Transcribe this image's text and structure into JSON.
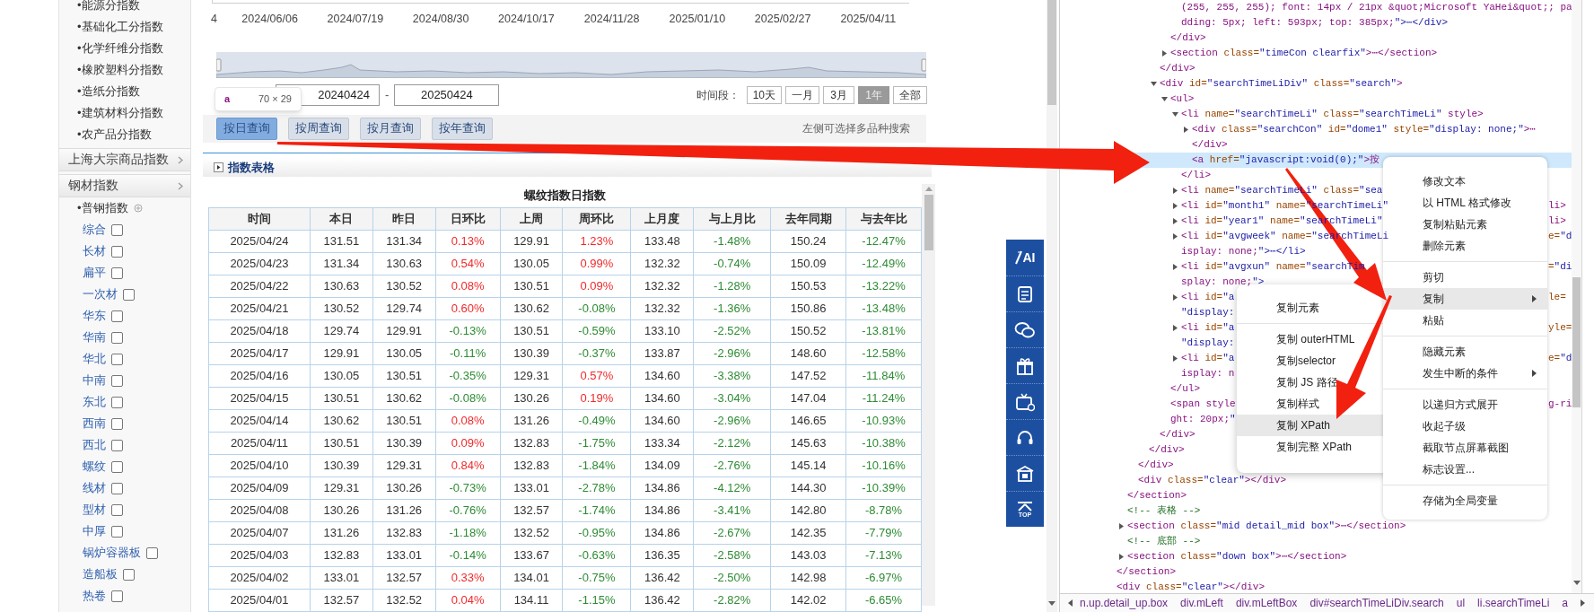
{
  "sidebar": {
    "sections": [
      {
        "items": [
          "•能源分指数",
          "•基础化工分指数",
          "•化学纤维分指数",
          "•橡胶塑料分指数",
          "•造纸分指数",
          "•建筑材料分指数",
          "•农产品分指数"
        ]
      },
      {
        "label": "上海大宗商品指数"
      },
      {
        "label": "钢材指数",
        "children": [
          {
            "label": "•普钢指数",
            "children": [
              {
                "label": "综合",
                "checked": false
              },
              {
                "label": "长材",
                "checked": false
              },
              {
                "label": "扁平",
                "checked": false
              },
              {
                "label": "一次材",
                "checked": false
              },
              {
                "label": "华东",
                "checked": false
              },
              {
                "label": "华南",
                "checked": false
              },
              {
                "label": "华北",
                "checked": false
              },
              {
                "label": "中南",
                "checked": false
              },
              {
                "label": "东北",
                "checked": false
              },
              {
                "label": "西南",
                "checked": false
              },
              {
                "label": "西北",
                "checked": false
              },
              {
                "label": "螺纹",
                "checked": false
              },
              {
                "label": "线材",
                "checked": false
              },
              {
                "label": "型材",
                "checked": false
              },
              {
                "label": "中厚",
                "checked": false
              },
              {
                "label": "锅炉容器板",
                "checked": false
              },
              {
                "label": "造船板",
                "checked": false
              },
              {
                "label": "热卷",
                "checked": false
              }
            ]
          }
        ]
      }
    ]
  },
  "chart": {
    "axis_labels": [
      "4",
      "2024/06/06",
      "2024/07/19",
      "2024/08/30",
      "2024/10/17",
      "2024/11/28",
      "2025/01/10",
      "2025/02/27",
      "2025/04/11"
    ]
  },
  "date_range": {
    "start": "20240424",
    "separator": "-",
    "end": "20250424"
  },
  "period": {
    "label": "时间段：",
    "options": [
      {
        "label": "10天",
        "selected": false
      },
      {
        "label": "一月",
        "selected": false
      },
      {
        "label": "3月",
        "selected": false
      },
      {
        "label": "1年",
        "selected": true
      },
      {
        "label": "全部",
        "selected": false
      }
    ]
  },
  "query_buttons": [
    {
      "label": "按日查询",
      "selected": true
    },
    {
      "label": "按周查询",
      "selected": false
    },
    {
      "label": "按月查询",
      "selected": false
    },
    {
      "label": "按年查询",
      "selected": false
    }
  ],
  "hint": "左侧可选择多品种搜索",
  "tooltip": {
    "tag": "a",
    "size": "70 × 29"
  },
  "section": {
    "title": "指数表格"
  },
  "table": {
    "title": "螺纹指数日指数",
    "columns": [
      "时间",
      "本日",
      "昨日",
      "日环比",
      "上周",
      "周环比",
      "上月度",
      "与上月比",
      "去年同期",
      "与去年比"
    ],
    "rows": [
      [
        "2025/04/24",
        "131.51",
        "131.34",
        {
          "text": "0.13%",
          "color": "#f02a2a"
        },
        "129.91",
        {
          "text": "1.23%",
          "color": "#f02a2a"
        },
        "133.48",
        {
          "text": "-1.48%",
          "color": "#2e8b34"
        },
        "150.24",
        {
          "text": "-12.47%",
          "color": "#2e8b34"
        }
      ],
      [
        "2025/04/23",
        "131.34",
        "130.63",
        {
          "text": "0.54%",
          "color": "#f02a2a"
        },
        "130.05",
        {
          "text": "0.99%",
          "color": "#f02a2a"
        },
        "132.32",
        {
          "text": "-0.74%",
          "color": "#2e8b34"
        },
        "150.09",
        {
          "text": "-12.49%",
          "color": "#2e8b34"
        }
      ],
      [
        "2025/04/22",
        "130.63",
        "130.52",
        {
          "text": "0.08%",
          "color": "#f02a2a"
        },
        "130.51",
        {
          "text": "0.09%",
          "color": "#f02a2a"
        },
        "132.32",
        {
          "text": "-1.28%",
          "color": "#2e8b34"
        },
        "150.53",
        {
          "text": "-13.22%",
          "color": "#2e8b34"
        }
      ],
      [
        "2025/04/21",
        "130.52",
        "129.74",
        {
          "text": "0.60%",
          "color": "#f02a2a"
        },
        "130.62",
        {
          "text": "-0.08%",
          "color": "#2e8b34"
        },
        "132.32",
        {
          "text": "-1.36%",
          "color": "#2e8b34"
        },
        "150.86",
        {
          "text": "-13.48%",
          "color": "#2e8b34"
        }
      ],
      [
        "2025/04/18",
        "129.74",
        "129.91",
        {
          "text": "-0.13%",
          "color": "#2e8b34"
        },
        "130.51",
        {
          "text": "-0.59%",
          "color": "#2e8b34"
        },
        "133.10",
        {
          "text": "-2.52%",
          "color": "#2e8b34"
        },
        "150.52",
        {
          "text": "-13.81%",
          "color": "#2e8b34"
        }
      ],
      [
        "2025/04/17",
        "129.91",
        "130.05",
        {
          "text": "-0.11%",
          "color": "#2e8b34"
        },
        "130.39",
        {
          "text": "-0.37%",
          "color": "#2e8b34"
        },
        "133.87",
        {
          "text": "-2.96%",
          "color": "#2e8b34"
        },
        "148.60",
        {
          "text": "-12.58%",
          "color": "#2e8b34"
        }
      ],
      [
        "2025/04/16",
        "130.05",
        "130.51",
        {
          "text": "-0.35%",
          "color": "#2e8b34"
        },
        "129.31",
        {
          "text": "0.57%",
          "color": "#f02a2a"
        },
        "134.60",
        {
          "text": "-3.38%",
          "color": "#2e8b34"
        },
        "147.52",
        {
          "text": "-11.84%",
          "color": "#2e8b34"
        }
      ],
      [
        "2025/04/15",
        "130.51",
        "130.62",
        {
          "text": "-0.08%",
          "color": "#2e8b34"
        },
        "130.26",
        {
          "text": "0.19%",
          "color": "#f02a2a"
        },
        "134.60",
        {
          "text": "-3.04%",
          "color": "#2e8b34"
        },
        "147.04",
        {
          "text": "-11.24%",
          "color": "#2e8b34"
        }
      ],
      [
        "2025/04/14",
        "130.62",
        "130.51",
        {
          "text": "0.08%",
          "color": "#f02a2a"
        },
        "131.26",
        {
          "text": "-0.49%",
          "color": "#2e8b34"
        },
        "134.60",
        {
          "text": "-2.96%",
          "color": "#2e8b34"
        },
        "146.65",
        {
          "text": "-10.93%",
          "color": "#2e8b34"
        }
      ],
      [
        "2025/04/11",
        "130.51",
        "130.39",
        {
          "text": "0.09%",
          "color": "#f02a2a"
        },
        "132.83",
        {
          "text": "-1.75%",
          "color": "#2e8b34"
        },
        "133.34",
        {
          "text": "-2.12%",
          "color": "#2e8b34"
        },
        "145.63",
        {
          "text": "-10.38%",
          "color": "#2e8b34"
        }
      ],
      [
        "2025/04/10",
        "130.39",
        "129.31",
        {
          "text": "0.84%",
          "color": "#f02a2a"
        },
        "132.83",
        {
          "text": "-1.84%",
          "color": "#2e8b34"
        },
        "134.09",
        {
          "text": "-2.76%",
          "color": "#2e8b34"
        },
        "145.14",
        {
          "text": "-10.16%",
          "color": "#2e8b34"
        }
      ],
      [
        "2025/04/09",
        "129.31",
        "130.26",
        {
          "text": "-0.73%",
          "color": "#2e8b34"
        },
        "133.01",
        {
          "text": "-2.78%",
          "color": "#2e8b34"
        },
        "134.86",
        {
          "text": "-4.12%",
          "color": "#2e8b34"
        },
        "144.30",
        {
          "text": "-10.39%",
          "color": "#2e8b34"
        }
      ],
      [
        "2025/04/08",
        "130.26",
        "131.26",
        {
          "text": "-0.76%",
          "color": "#2e8b34"
        },
        "132.57",
        {
          "text": "-1.74%",
          "color": "#2e8b34"
        },
        "134.86",
        {
          "text": "-3.41%",
          "color": "#2e8b34"
        },
        "142.80",
        {
          "text": "-8.78%",
          "color": "#2e8b34"
        }
      ],
      [
        "2025/04/07",
        "131.26",
        "132.83",
        {
          "text": "-1.18%",
          "color": "#2e8b34"
        },
        "132.52",
        {
          "text": "-0.95%",
          "color": "#2e8b34"
        },
        "134.86",
        {
          "text": "-2.67%",
          "color": "#2e8b34"
        },
        "142.35",
        {
          "text": "-7.79%",
          "color": "#2e8b34"
        }
      ],
      [
        "2025/04/03",
        "132.83",
        "133.01",
        {
          "text": "-0.14%",
          "color": "#2e8b34"
        },
        "133.67",
        {
          "text": "-0.63%",
          "color": "#2e8b34"
        },
        "136.35",
        {
          "text": "-2.58%",
          "color": "#2e8b34"
        },
        "143.03",
        {
          "text": "-7.13%",
          "color": "#2e8b34"
        }
      ],
      [
        "2025/04/02",
        "133.01",
        "132.57",
        {
          "text": "0.33%",
          "color": "#f02a2a"
        },
        "134.01",
        {
          "text": "-0.75%",
          "color": "#2e8b34"
        },
        "136.42",
        {
          "text": "-2.50%",
          "color": "#2e8b34"
        },
        "142.98",
        {
          "text": "-6.97%",
          "color": "#2e8b34"
        }
      ],
      [
        "2025/04/01",
        "132.57",
        "132.52",
        {
          "text": "0.04%",
          "color": "#f02a2a"
        },
        "134.11",
        {
          "text": "-1.15%",
          "color": "#2e8b34"
        },
        "136.42",
        {
          "text": "-2.82%",
          "color": "#2e8b34"
        },
        "142.02",
        {
          "text": "-6.65%",
          "color": "#2e8b34"
        }
      ]
    ]
  },
  "side_toolbar": [
    {
      "kind": "ai",
      "label": "AI"
    },
    {
      "kind": "scan"
    },
    {
      "kind": "chat"
    },
    {
      "kind": "gift"
    },
    {
      "kind": "tv"
    },
    {
      "kind": "headset"
    },
    {
      "kind": "building"
    },
    {
      "kind": "top",
      "label": "TOP"
    }
  ],
  "devtools": {
    "tree": [
      {
        "closing": "</section>",
        "children": [
          {
            "closing": "</section>",
            "children": [
              {
                "closing": "</div>",
                "children": [
                  {
                    "closing": "</div>",
                    "children": [
                      {
                        "closing": "</div>",
                        "children": [
                          {
                            "closing": "</div>",
                            "children": [
                              {
                                "selected": false,
                                "rows": [
                                  {
                                    "text": "(255, 255, 255); font: 14px / 21px &quot;Microsoft YaHei&quot;; pa"
                                  },
                                  {
                                    "text": "dding: 5px; left: 593px; top: 385px;\">⋯</div>"
                                  }
                                ]
                              }
                            ]
                          },
                          {
                            "selected": false,
                            "expanded": false,
                            "rows": [
                              {
                                "text": "<section class=\"timeCon clearfix\">⋯</section>"
                              }
                            ]
                          }
                        ]
                      },
                      {
                        "selected": false,
                        "expanded": true,
                        "rows": [
                          {
                            "text": "<div id=\"searchTimeLiDiv\" class=\"search\">"
                          }
                        ],
                        "closing": "</div>",
                        "children": [
                          {
                            "selected": false,
                            "expanded": true,
                            "rows": [
                              {
                                "text": "<ul>"
                              }
                            ],
                            "closing": "</ul>",
                            "children": [
                              {
                                "selected": false,
                                "expanded": true,
                                "rows": [
                                  {
                                    "text": "<li name=\"searchTimeLi\" class=\"searchTimeLi\" style>"
                                  }
                                ],
                                "closing": "</li>",
                                "children": [
                                  {
                                    "selected": false,
                                    "expanded": false,
                                    "rows": [
                                      {
                                        "text": "<div class=\"searchCon\" id=\"dome1\" style=\"display: none;\">⋯"
                                      },
                                      {
                                        "text": "</div>"
                                      }
                                    ]
                                  },
                                  {
                                    "selected": true,
                                    "rows": [
                                      {
                                        "text": "<a href=\"javascript:void(0);\">按"
                                      }
                                    ]
                                  }
                                ]
                              },
                              {
                                "selected": false,
                                "expanded": false,
                                "rows": [
                                  {
                                    "text": "<li name=\"searchTimeLi\" class=\"sea"
                                  }
                                ]
                              },
                              {
                                "selected": false,
                                "expanded": false,
                                "rows": [
                                  {
                                    "text": "<li id=\"month1\" name=\"searchTimeLi\"",
                                    "tail": "li>"
                                  }
                                ]
                              },
                              {
                                "selected": false,
                                "expanded": false,
                                "rows": [
                                  {
                                    "text": "<li id=\"year1\" name=\"searchTimeLi\"",
                                    "tail": "li>"
                                  }
                                ]
                              },
                              {
                                "selected": false,
                                "expanded": false,
                                "rows": [
                                  {
                                    "text": "<li id=\"avgweek\" name=\"searchTimeLi",
                                    "tail": "e=\"d"
                                  },
                                  {
                                    "text": "isplay: none;\">⋯</li>"
                                  }
                                ]
                              },
                              {
                                "selected": false,
                                "expanded": false,
                                "rows": [
                                  {
                                    "text": "<li id=\"avgxun\" name=\"searchTim",
                                    "tail": "=\"di"
                                  },
                                  {
                                    "text": "splay: none;\">"
                                  }
                                ]
                              },
                              {
                                "selected": false,
                                "expanded": false,
                                "rows": [
                                  {
                                    "text": "<li id=\"a",
                                    "tail": "le="
                                  },
                                  {
                                    "text": "\"display:"
                                  }
                                ]
                              },
                              {
                                "selected": false,
                                "expanded": false,
                                "rows": [
                                  {
                                    "text": "<li id=\"a",
                                    "tail": "yle="
                                  },
                                  {
                                    "text": "\"display:"
                                  }
                                ]
                              },
                              {
                                "selected": false,
                                "expanded": false,
                                "rows": [
                                  {
                                    "text": "<li id=\"a",
                                    "tail": "e=\"d"
                                  },
                                  {
                                    "text": "isplay: n"
                                  }
                                ]
                              }
                            ]
                          },
                          {
                            "selected": false,
                            "rows": [
                              {
                                "text": "<span style",
                                "tail": "g-ri"
                              },
                              {
                                "text": "ght: 20px;\""
                              }
                            ]
                          }
                        ]
                      }
                    ]
                  }
                ]
              },
              {
                "selected": false,
                "rows": [
                  {
                    "text": "<div class=\"clear\"></div>"
                  }
                ]
              }
            ]
          },
          {
            "selected": false,
            "kind": "comment",
            "rows": [
              {
                "text": "<!-- 表格 -->"
              }
            ]
          },
          {
            "selected": false,
            "expanded": false,
            "rows": [
              {
                "text": "<section class=\"mid detail_mid box\">⋯</section>"
              }
            ]
          },
          {
            "selected": false,
            "kind": "comment",
            "rows": [
              {
                "text": "<!-- 底部 -->"
              }
            ]
          },
          {
            "selected": false,
            "expanded": false,
            "rows": [
              {
                "text": "<section class=\"down box\">⋯</section>"
              }
            ]
          }
        ]
      },
      {
        "selected": false,
        "rows": [
          {
            "text": "<div class=\"clear\"></div>"
          }
        ]
      }
    ],
    "breadcrumbs": [
      "n.up.detail_up.box",
      "div.mLeft",
      "div.mLeftBox",
      "div#searchTimeLiDiv.search",
      "ul",
      "li.searchTimeLi",
      "a"
    ]
  },
  "context_menu": {
    "groups": [
      [
        {
          "label": "修改文本",
          "selected": false
        },
        {
          "label": "以 HTML 格式修改",
          "selected": false
        },
        {
          "label": "复制粘贴元素",
          "selected": false
        },
        {
          "label": "删除元素",
          "selected": false
        }
      ],
      [
        {
          "label": "剪切",
          "selected": false
        },
        {
          "label": "复制",
          "selected": true,
          "submenu": true
        },
        {
          "label": "粘贴",
          "selected": false
        }
      ],
      [
        {
          "label": "隐藏元素",
          "selected": false
        },
        {
          "label": "发生中断的条件",
          "selected": false,
          "submenu": true
        }
      ],
      [
        {
          "label": "以递归方式展开",
          "selected": false
        },
        {
          "label": "收起子级",
          "selected": false
        },
        {
          "label": "截取节点屏幕截图",
          "selected": false
        },
        {
          "label": "标志设置...",
          "selected": false
        }
      ],
      [
        {
          "label": "存储为全局变量",
          "selected": false
        }
      ]
    ]
  },
  "submenu": {
    "groups": [
      [
        {
          "label": "复制元素",
          "selected": false
        }
      ],
      [
        {
          "label": "复制 outerHTML",
          "selected": false
        },
        {
          "label": "复制selector",
          "selected": false
        },
        {
          "label": "复制 JS 路径",
          "selected": false
        },
        {
          "label": "复制样式",
          "selected": false
        },
        {
          "label": "复制 XPath",
          "selected": true
        },
        {
          "label": "复制完整 XPath",
          "selected": false
        }
      ]
    ]
  },
  "annotations": [
    {
      "kind": "arrow"
    },
    {
      "kind": "arrow"
    },
    {
      "kind": "arrow"
    }
  ]
}
